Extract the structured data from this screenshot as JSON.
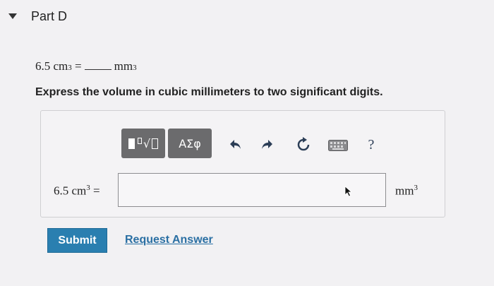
{
  "part": {
    "title": "Part D"
  },
  "question": {
    "value": "6.5",
    "unit_from": "cm",
    "unit_from_exp": "3",
    "equals": "=",
    "unit_to": "mm",
    "unit_to_exp": "3"
  },
  "instruction": "Express the volume in cubic millimeters to two significant digits.",
  "toolbar": {
    "greek_label": "ΑΣφ",
    "help_label": "?",
    "icons": [
      "templates-icon",
      "greek-symbols-icon",
      "undo-icon",
      "redo-icon",
      "reset-icon",
      "keyboard-icon",
      "help-icon"
    ]
  },
  "answer": {
    "left_value": "6.5",
    "left_unit": "cm",
    "left_exp": "3",
    "equals": "=",
    "input_value": "",
    "right_unit": "mm",
    "right_exp": "3"
  },
  "actions": {
    "submit_label": "Submit",
    "request_label": "Request Answer"
  },
  "colors": {
    "submit_bg": "#2a7fb0",
    "link": "#2a6fa3",
    "toolbar_button": "#6b6b6d"
  }
}
